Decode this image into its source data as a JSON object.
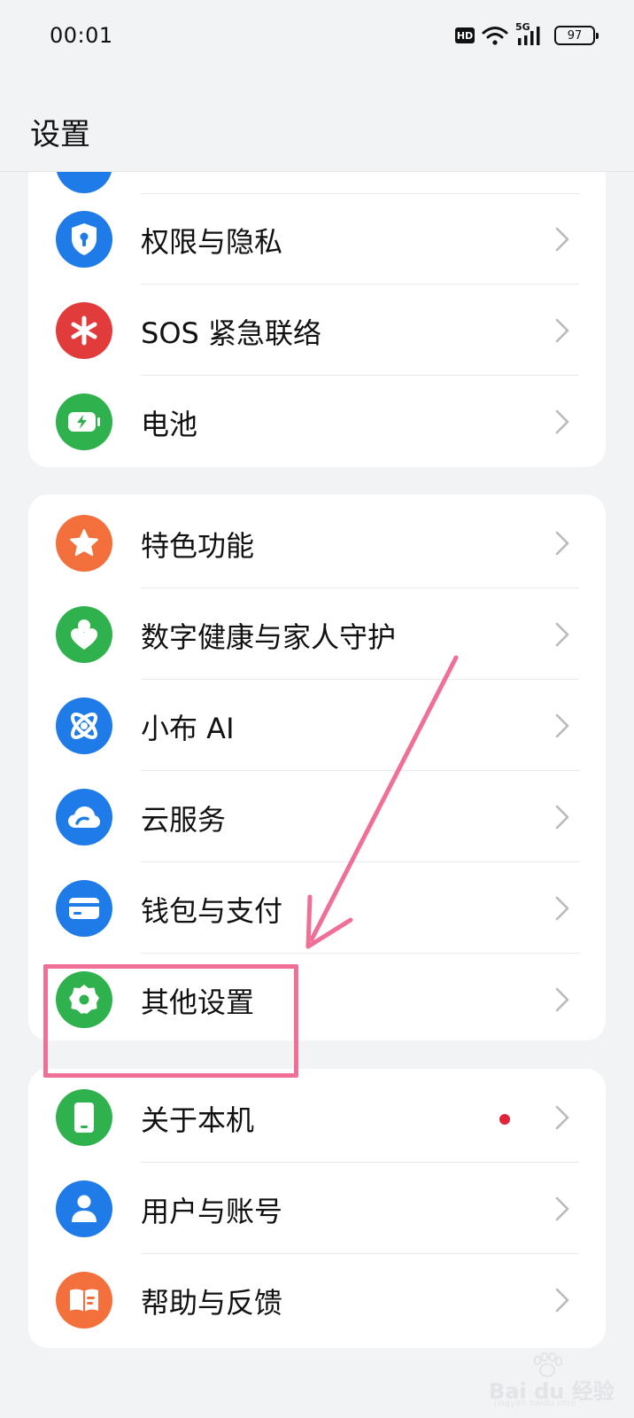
{
  "status_bar": {
    "time": "00:01",
    "hd_label": "HD",
    "network_label": "5G",
    "battery_level": "97"
  },
  "header": {
    "title": "设置"
  },
  "groups": [
    {
      "items": [
        {
          "label": "权限与隐私",
          "icon": "shield-keyhole-icon",
          "color": "#1f7be8"
        },
        {
          "label": "SOS 紧急联络",
          "icon": "sos-asterisk-icon",
          "color": "#e23b3b"
        },
        {
          "label": "电池",
          "icon": "battery-charging-icon",
          "color": "#2fb14d"
        }
      ]
    },
    {
      "items": [
        {
          "label": "特色功能",
          "icon": "star-icon",
          "color": "#f36f3b"
        },
        {
          "label": "数字健康与家人守护",
          "icon": "person-heart-icon",
          "color": "#2fb14d"
        },
        {
          "label": "小布 AI",
          "icon": "orbit-ai-icon",
          "color": "#1f7be8"
        },
        {
          "label": "云服务",
          "icon": "cloud-icon",
          "color": "#1f7be8"
        },
        {
          "label": "钱包与支付",
          "icon": "wallet-card-icon",
          "color": "#1f7be8"
        },
        {
          "label": "其他设置",
          "icon": "gear-icon",
          "color": "#2fb14d"
        }
      ]
    },
    {
      "items": [
        {
          "label": "关于本机",
          "icon": "phone-device-icon",
          "color": "#2fb14d",
          "badge": "red-dot"
        },
        {
          "label": "用户与账号",
          "icon": "user-icon",
          "color": "#1f7be8"
        },
        {
          "label": "帮助与反馈",
          "icon": "help-book-icon",
          "color": "#f36f3b"
        }
      ]
    }
  ],
  "watermark": {
    "text": "Bai du 经验",
    "sub": "jingyan.baidu.com"
  },
  "colors": {
    "background": "#f2f3f5",
    "card": "#ffffff",
    "annotation": "#ef6f96",
    "badge": "#e0243a"
  }
}
